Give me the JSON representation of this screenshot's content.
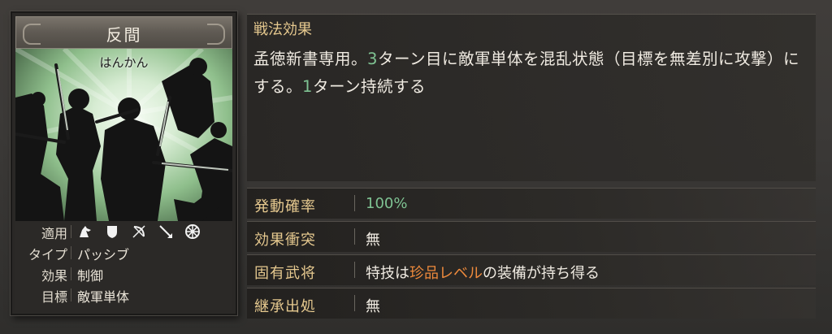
{
  "card": {
    "title": "反間",
    "reading": "はんかん",
    "info": {
      "applicable_label": "適用",
      "applicable_icons": [
        "cavalry-icon",
        "shield-icon",
        "bow-icon",
        "spear-icon",
        "wheel-icon"
      ],
      "type_label": "タイプ",
      "type_value": "パッシブ",
      "effect_label": "効果",
      "effect_value": "制御",
      "target_label": "目標",
      "target_value": "敵軍単体"
    }
  },
  "description": {
    "title": "戦法効果",
    "seg1": "孟徳新書専用。",
    "num1": "3",
    "seg2": "ターン目に敵軍単体を混乱状態（目標を無差別に攻撃）にする。",
    "num2": "1",
    "seg3": "ターン持続する"
  },
  "stats": {
    "activation": {
      "label": "発動確率",
      "value": "100%"
    },
    "conflict": {
      "label": "効果衝突",
      "value": "無"
    },
    "unique": {
      "label": "固有武将",
      "value_pre": "特技は",
      "value_highlight": "珍品レベル",
      "value_post": "の装備が持ち得る"
    },
    "inherit": {
      "label": "継承出処",
      "value": "無"
    }
  }
}
